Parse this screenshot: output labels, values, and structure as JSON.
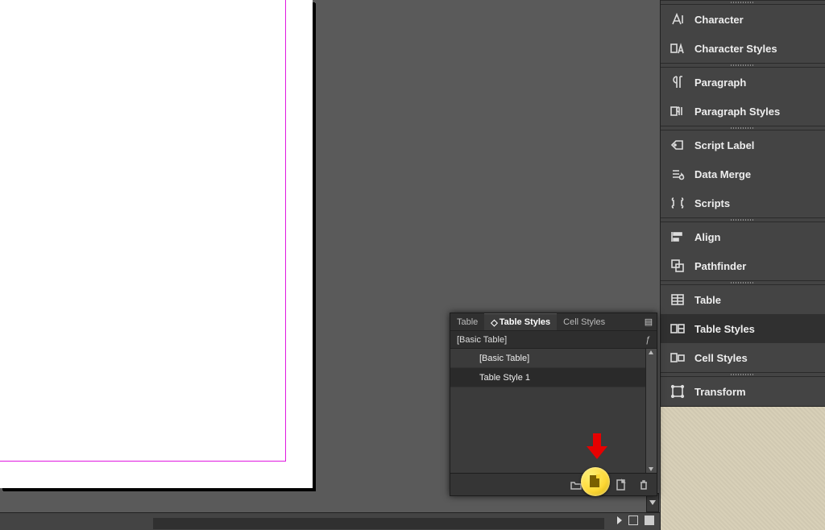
{
  "right_panel": {
    "items": [
      {
        "key": "character",
        "label": "Character"
      },
      {
        "key": "character-styles",
        "label": "Character Styles"
      },
      {
        "key": "paragraph",
        "label": "Paragraph"
      },
      {
        "key": "paragraph-styles",
        "label": "Paragraph Styles"
      },
      {
        "key": "script-label",
        "label": "Script Label"
      },
      {
        "key": "data-merge",
        "label": "Data Merge"
      },
      {
        "key": "scripts",
        "label": "Scripts"
      },
      {
        "key": "align",
        "label": "Align"
      },
      {
        "key": "pathfinder",
        "label": "Pathfinder"
      },
      {
        "key": "table",
        "label": "Table"
      },
      {
        "key": "table-styles",
        "label": "Table Styles"
      },
      {
        "key": "cell-styles",
        "label": "Cell Styles"
      },
      {
        "key": "transform",
        "label": "Transform"
      }
    ],
    "active_key": "table-styles"
  },
  "table_styles_panel": {
    "tabs": {
      "table": "Table",
      "table_styles": "Table Styles",
      "cell_styles": "Cell Styles"
    },
    "current": "[Basic Table]",
    "rows": [
      "[Basic Table]",
      "Table Style 1"
    ]
  }
}
